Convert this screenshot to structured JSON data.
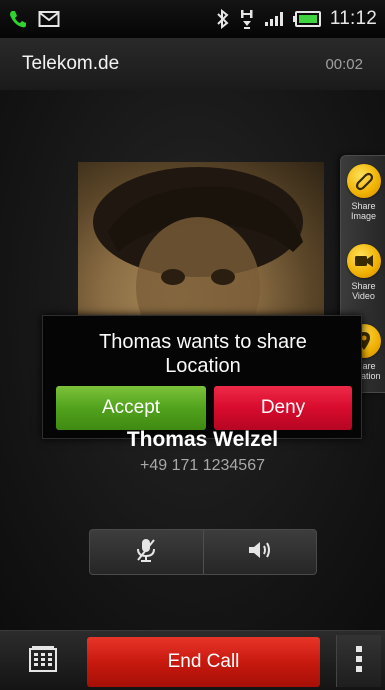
{
  "status_bar": {
    "time": "11:12",
    "left_icons": [
      "phone-call-icon",
      "message-icon"
    ],
    "right_icons": [
      "bluetooth-icon",
      "data-transfer-icon",
      "signal-icon",
      "battery-icon"
    ]
  },
  "carrier_bar": {
    "carrier": "Telekom.de",
    "timer": "00:02"
  },
  "share_panel": {
    "items": [
      {
        "label_line1": "Share",
        "label_line2": "Image",
        "icon": "paperclip-icon"
      },
      {
        "label_line1": "Share",
        "label_line2": "Video",
        "icon": "video-icon"
      },
      {
        "label_line1": "Share",
        "label_line2": "Location",
        "icon": "location-pin-icon"
      }
    ]
  },
  "dialog": {
    "message_line1": "Thomas wants to share",
    "message_line2": "Location",
    "accept_label": "Accept",
    "deny_label": "Deny"
  },
  "caller": {
    "name": "Thomas Welzel",
    "number": "+49 171 1234567"
  },
  "audio_controls": {
    "mute_icon": "microphone-icon",
    "speaker_icon": "speaker-icon"
  },
  "bottom_bar": {
    "end_call_label": "End Call",
    "dialpad_icon": "dialpad-icon",
    "menu_icon": "menu-icon"
  },
  "colors": {
    "accept": "#52a21d",
    "deny": "#d80b2d",
    "end_call": "#c8190e",
    "share_icon": "#f0b000"
  }
}
